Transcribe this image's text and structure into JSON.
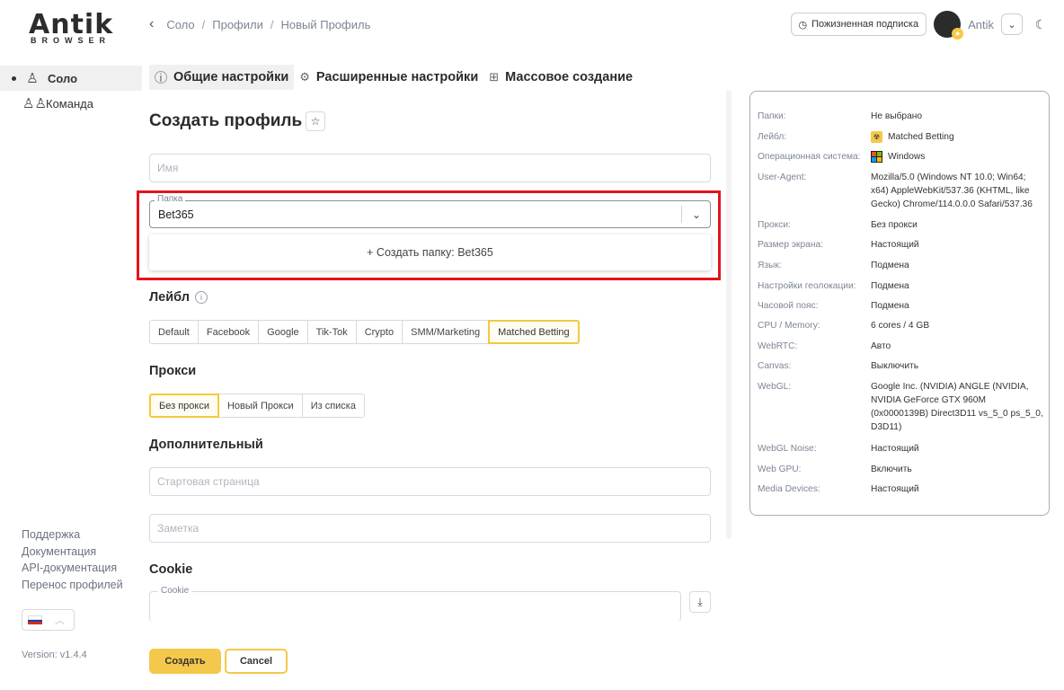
{
  "logo": {
    "word": "Antik",
    "sub": "BROWSER"
  },
  "breadcrumb": [
    "Соло",
    "Профили",
    "Новый Профиль"
  ],
  "header": {
    "subscription_label": "Пожизненная подписка",
    "user_name": "Antik"
  },
  "sidebar": {
    "items": [
      {
        "label": "Соло",
        "active": true
      },
      {
        "label": "Команда",
        "active": false
      }
    ],
    "links": [
      "Поддержка",
      "Документация",
      "API-документация",
      "Перенос профилей"
    ],
    "version": "Version: v1.4.4"
  },
  "tabs": [
    {
      "label": "Общие настройки",
      "icon": "info-icon",
      "active": true
    },
    {
      "label": "Расширенные настройки",
      "icon": "gear-icon",
      "active": false
    },
    {
      "label": "Массовое создание",
      "icon": "grid-icon",
      "active": false
    }
  ],
  "form": {
    "title": "Создать профиль",
    "name_placeholder": "Имя",
    "folder_label": "Папка",
    "folder_value": "Bet365",
    "folder_option": "+ Создать папку: Bet365",
    "label_title": "Лейбл",
    "labels": [
      "Default",
      "Facebook",
      "Google",
      "Tik-Tok",
      "Crypto",
      "SMM/Marketing",
      "Matched Betting"
    ],
    "label_selected": "Matched Betting",
    "proxy_title": "Прокси",
    "proxy_options": [
      "Без прокси",
      "Новый Прокси",
      "Из списка"
    ],
    "proxy_selected": "Без прокси",
    "extra_title": "Дополнительный",
    "start_page_placeholder": "Стартовая страница",
    "note_placeholder": "Заметка",
    "cookie_title": "Cookie",
    "cookie_label": "Cookie",
    "create_label": "Создать",
    "cancel_label": "Cancel"
  },
  "summary": [
    {
      "key": "Папки:",
      "value": "Не выбрано"
    },
    {
      "key": "Лейбл:",
      "value": "Matched Betting",
      "icon": "label-icon"
    },
    {
      "key": "Операционная система:",
      "value": "Windows",
      "icon": "windows-icon"
    },
    {
      "key": "User-Agent:",
      "value": "Mozilla/5.0 (Windows NT 10.0; Win64; x64) AppleWebKit/537.36 (KHTML, like Gecko) Chrome/114.0.0.0 Safari/537.36"
    },
    {
      "key": "Прокси:",
      "value": "Без прокси"
    },
    {
      "key": "Размер экрана:",
      "value": "Настоящий"
    },
    {
      "key": "Язык:",
      "value": "Подмена"
    },
    {
      "key": "Настройки геолокации:",
      "value": "Подмена"
    },
    {
      "key": "Часовой пояс:",
      "value": "Подмена"
    },
    {
      "key": "CPU / Memory:",
      "value": "6 cores / 4 GB"
    },
    {
      "key": "WebRTC:",
      "value": "Авто"
    },
    {
      "key": "Canvas:",
      "value": "Выключить"
    },
    {
      "key": "WebGL:",
      "value": "Google Inc. (NVIDIA) ANGLE (NVIDIA, NVIDIA GeForce GTX 960M (0x0000139B) Direct3D11 vs_5_0 ps_5_0, D3D11)"
    },
    {
      "key": "WebGL Noise:",
      "value": "Настоящий"
    },
    {
      "key": "Web GPU:",
      "value": "Включить"
    },
    {
      "key": "Media Devices:",
      "value": "Настоящий"
    }
  ],
  "colors": {
    "accent": "#f4c84a",
    "highlight": "#e4141c"
  }
}
